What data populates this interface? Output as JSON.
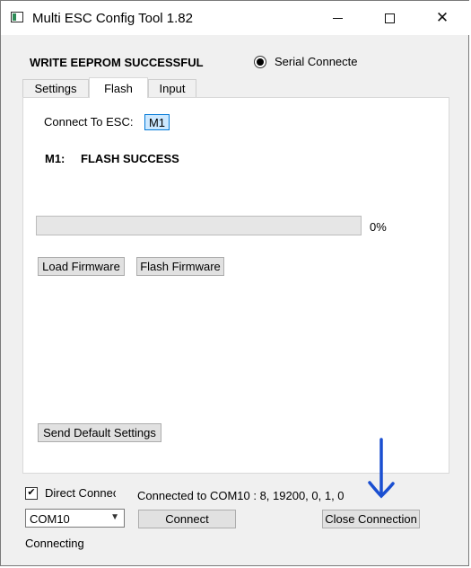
{
  "window": {
    "title": "Multi ESC Config Tool 1.82"
  },
  "header": {
    "status_message": "WRITE EEPROM SUCCESSFUL",
    "mode_option_label": "Serial Connecte",
    "mode_option_selected": true
  },
  "tabs": [
    {
      "label": "Settings",
      "active": false
    },
    {
      "label": "Flash",
      "active": true
    },
    {
      "label": "Input",
      "active": false
    }
  ],
  "flash_panel": {
    "connect_label": "Connect To ESC:",
    "esc_selected": "M1",
    "esc_id": "M1:",
    "esc_message": "FLASH SUCCESS",
    "progress_percent": 0,
    "progress_text": "0%",
    "load_firmware_label": "Load Firmware",
    "flash_firmware_label": "Flash Firmware",
    "send_defaults_label": "Send Default Settings"
  },
  "footer": {
    "direct_connect_label": "Direct Connec",
    "direct_connect_checked": true,
    "connection_info": "Connected to COM10 : 8, 19200, 0, 1, 0",
    "com_port_value": "COM10",
    "connect_label": "Connect",
    "close_connection_label": "Close Connection",
    "status_text": "Connecting"
  },
  "colors": {
    "annotation_arrow": "#1a4fd1",
    "selection_highlight": "#cce8ff",
    "button_face": "#e1e1e1"
  }
}
